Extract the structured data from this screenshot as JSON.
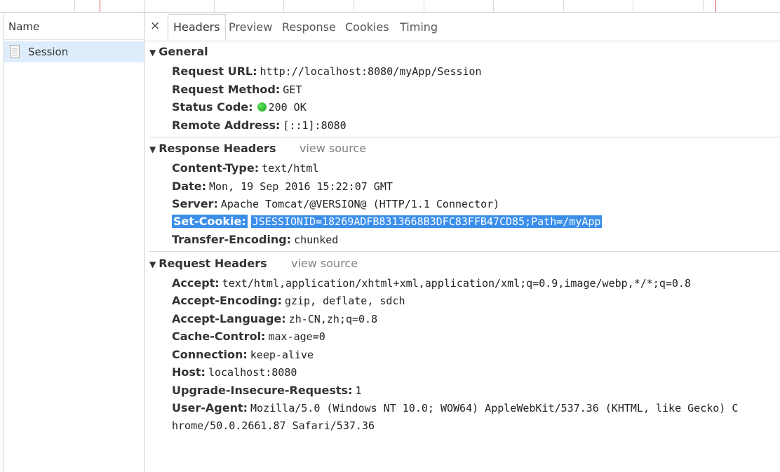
{
  "left_pane": {
    "header": "Name",
    "requests": [
      {
        "name": "Session",
        "icon": "document-icon"
      }
    ]
  },
  "tabs": {
    "close_glyph": "×",
    "items": [
      "Headers",
      "Preview",
      "Response",
      "Cookies",
      "Timing"
    ],
    "active": "Headers"
  },
  "general": {
    "title": "General",
    "request_url": {
      "key": "Request URL:",
      "value": "http://localhost:8080/myApp/Session"
    },
    "request_method": {
      "key": "Request Method:",
      "value": "GET"
    },
    "status_code": {
      "key": "Status Code:",
      "value": "200 OK",
      "status_color": "#2cc12c"
    },
    "remote_address": {
      "key": "Remote Address:",
      "value": "[::1]:8080"
    }
  },
  "response_headers": {
    "title": "Response Headers",
    "view_source": "view source",
    "content_type": {
      "key": "Content-Type:",
      "value": "text/html"
    },
    "date": {
      "key": "Date:",
      "value": "Mon, 19 Sep 2016 15:22:07 GMT"
    },
    "server": {
      "key": "Server:",
      "value": "Apache Tomcat/@VERSION@ (HTTP/1.1 Connector)"
    },
    "set_cookie": {
      "key": "Set-Cookie:",
      "value": "JSESSIONID=18269ADFB8313668B3DFC83FFB47CD85;Path=/myApp",
      "selected": true
    },
    "transfer_encoding": {
      "key": "Transfer-Encoding:",
      "value": "chunked"
    }
  },
  "request_headers": {
    "title": "Request Headers",
    "view_source": "view source",
    "accept": {
      "key": "Accept:",
      "value": "text/html,application/xhtml+xml,application/xml;q=0.9,image/webp,*/*;q=0.8"
    },
    "accept_encoding": {
      "key": "Accept-Encoding:",
      "value": "gzip, deflate, sdch"
    },
    "accept_language": {
      "key": "Accept-Language:",
      "value": "zh-CN,zh;q=0.8"
    },
    "cache_control": {
      "key": "Cache-Control:",
      "value": "max-age=0"
    },
    "connection": {
      "key": "Connection:",
      "value": "keep-alive"
    },
    "host": {
      "key": "Host:",
      "value": "localhost:8080"
    },
    "upgrade_insecure_requests": {
      "key": "Upgrade-Insecure-Requests:",
      "value": "1"
    },
    "user_agent": {
      "key": "User-Agent:",
      "value": "Mozilla/5.0 (Windows NT 10.0; WOW64) AppleWebKit/537.36 (KHTML, like Gecko) C",
      "value_cont": "hrome/50.0.2661.87 Safari/537.36"
    }
  },
  "colors": {
    "selection": "#3b8fea",
    "selected_row": "#deedfb",
    "link_gray": "#808080"
  }
}
